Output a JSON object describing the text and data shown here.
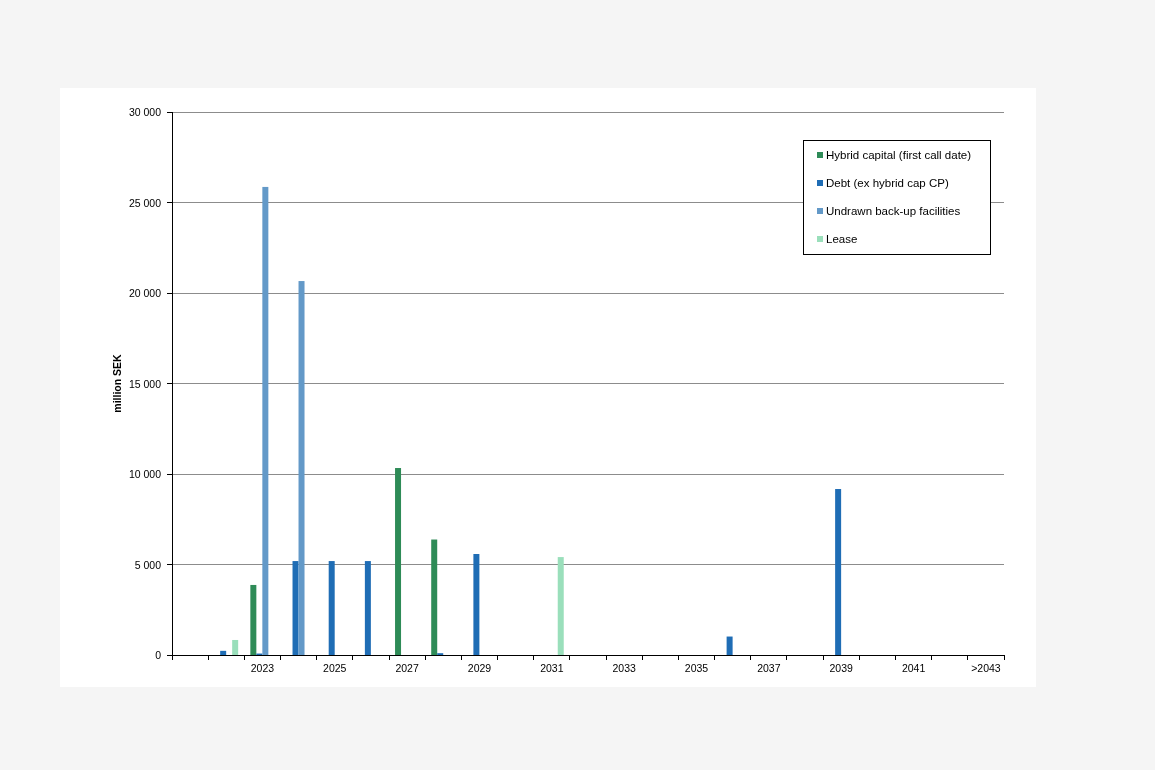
{
  "chart_data": {
    "type": "bar",
    "ylabel": "million SEK",
    "stacked": false,
    "grid": true,
    "legend": "upper right",
    "categories": [
      null,
      null,
      "2023",
      null,
      "2025",
      null,
      "2027",
      null,
      "2029",
      null,
      "2031",
      null,
      "2033",
      null,
      "2035",
      null,
      "2037",
      null,
      "2039",
      null,
      "2041",
      null,
      ">2043"
    ],
    "ylim": [
      0,
      30000
    ],
    "yticks": [
      {
        "value": 0,
        "label": "0"
      },
      {
        "value": 5000,
        "label": "5 000"
      },
      {
        "value": 10000,
        "label": "10 000"
      },
      {
        "value": 15000,
        "label": "15 000"
      },
      {
        "value": 20000,
        "label": "20 000"
      },
      {
        "value": 25000,
        "label": "25 000"
      },
      {
        "value": 30000,
        "label": "30 000"
      }
    ],
    "series": [
      {
        "name": "Hybrid capital (first call date)",
        "color": "#2e8b57",
        "values": [
          null,
          null,
          3870,
          null,
          null,
          null,
          10330,
          6380,
          null,
          null,
          null,
          null,
          null,
          null,
          null,
          null,
          null,
          null,
          null,
          null,
          null,
          null,
          null
        ]
      },
      {
        "name": "Debt (ex hybrid cap CP)",
        "color": "#1f6db5",
        "values": [
          null,
          230,
          80,
          5190,
          5190,
          5190,
          null,
          100,
          5580,
          null,
          null,
          null,
          null,
          null,
          null,
          1020,
          null,
          null,
          9170,
          null,
          null,
          null,
          null
        ]
      },
      {
        "name": "Undrawn back-up facilities",
        "color": "#6399c8",
        "values": [
          null,
          null,
          25860,
          20660,
          null,
          null,
          null,
          null,
          null,
          null,
          null,
          null,
          null,
          null,
          null,
          null,
          null,
          null,
          null,
          null,
          null,
          null,
          null
        ]
      },
      {
        "name": "Lease",
        "color": "#9adfbb",
        "values": [
          null,
          830,
          null,
          null,
          null,
          null,
          null,
          null,
          null,
          null,
          5410,
          null,
          null,
          null,
          null,
          null,
          null,
          null,
          null,
          null,
          null,
          null,
          null
        ]
      }
    ]
  }
}
